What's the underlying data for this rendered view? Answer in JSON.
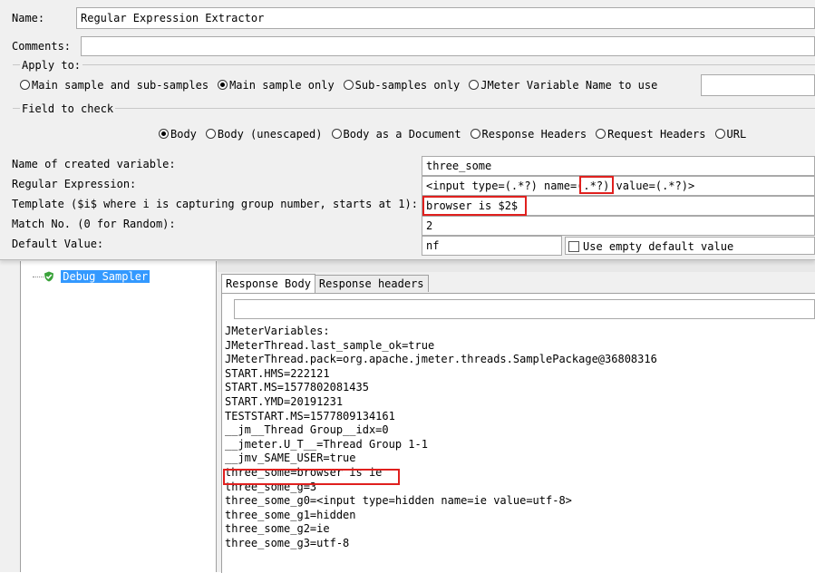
{
  "extractor": {
    "name_label": "Name:",
    "name_value": "Regular Expression Extractor",
    "comments_label": "Comments:",
    "comments_value": "",
    "apply_to": {
      "title": "Apply to:",
      "options": [
        "Main sample and sub-samples",
        "Main sample only",
        "Sub-samples only",
        "JMeter Variable Name to use"
      ],
      "selected": "Main sample only",
      "variable_input": ""
    },
    "field_to_check": {
      "title": "Field to check",
      "options": [
        "Body",
        "Body (unescaped)",
        "Body as a Document",
        "Response Headers",
        "Request Headers",
        "URL"
      ],
      "selected": "Body"
    },
    "ref_name_label": "Name of created variable:",
    "ref_name_value": "three_some",
    "regex_label": "Regular Expression:",
    "regex_value": "<input type=(.*?) name=(.*?) value=(.*?)>",
    "template_label": "Template ($i$ where i is capturing group number, starts at 1):",
    "template_value": "browser is $2$",
    "match_label": "Match No. (0 for Random):",
    "match_value": "2",
    "default_label": "Default Value:",
    "default_value": "nf",
    "use_empty_label": "Use empty default value"
  },
  "tree": {
    "item_label": "Debug Sampler"
  },
  "results": {
    "tabs": [
      "Response Body",
      "Response headers"
    ],
    "active_tab": "Response Body",
    "search_value": "",
    "lines": [
      "JMeterVariables:",
      "JMeterThread.last_sample_ok=true",
      "JMeterThread.pack=org.apache.jmeter.threads.SamplePackage@36808316",
      "START.HMS=222121",
      "START.MS=1577802081435",
      "START.YMD=20191231",
      "TESTSTART.MS=1577809134161",
      "__jm__Thread Group__idx=0",
      "__jmeter.U_T__=Thread Group 1-1",
      "__jmv_SAME_USER=true",
      "three_some=browser is ie",
      "three_some_g=3",
      "three_some_g0=<input type=hidden name=ie value=utf-8>",
      "three_some_g1=hidden",
      "three_some_g2=ie",
      "three_some_g3=utf-8"
    ]
  },
  "colors": {
    "panel_bg": "#f0f0f0",
    "highlight": "#e0201e",
    "selection": "#3399ff",
    "check_green": "#3aa23a"
  }
}
